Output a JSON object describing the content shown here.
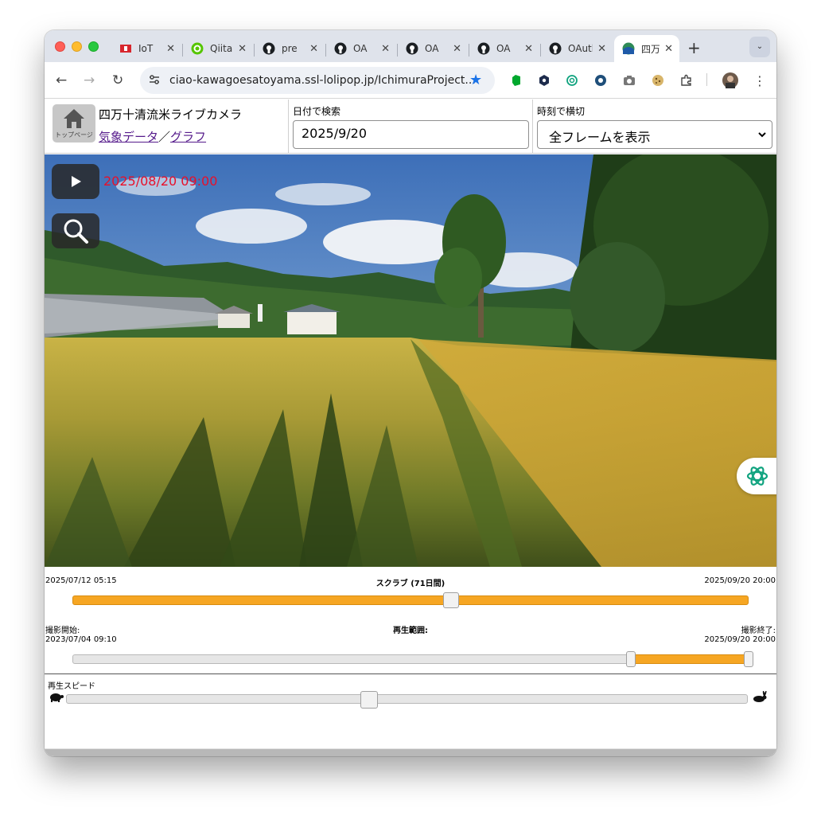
{
  "browser": {
    "tabs": [
      {
        "title": "IoT",
        "icon": "ticket-icon"
      },
      {
        "title": "Qiita",
        "icon": "qiita-icon"
      },
      {
        "title": "pre",
        "icon": "github-icon"
      },
      {
        "title": "OA",
        "icon": "github-icon"
      },
      {
        "title": "OA",
        "icon": "github-icon"
      },
      {
        "title": "OA",
        "icon": "github-icon"
      },
      {
        "title": "OAuth",
        "icon": "github-icon"
      },
      {
        "title": "四万",
        "icon": "site-icon",
        "active": true
      }
    ],
    "url": "ciao-kawagoesatoyama.ssl-lolipop.jp/IchimuraProject...",
    "accent": "#1a73e8"
  },
  "header": {
    "home_label": "トップページ",
    "title": "四万十清流米ライブカメラ",
    "link_weather": "気象データ",
    "link_sep": "／",
    "link_graph": "グラフ",
    "date_search_label": "日付で検索",
    "date_value": "2025/9/20",
    "time_label": "時刻で横切",
    "time_selected": "全フレームを表示"
  },
  "camera": {
    "timestamp": "2025/08/20 09:00"
  },
  "scrub": {
    "start": "2025/07/12 05:15",
    "title": "スクラブ (71日間)",
    "end": "2025/09/20 20:00",
    "position": 0.56
  },
  "range": {
    "start_label": "撮影開始:",
    "start": "2023/07/04 09:10",
    "title": "再生範囲:",
    "end_label": "撮影終了:",
    "end": "2025/09/20 20:00",
    "low": 0.826,
    "high": 1.0
  },
  "speed": {
    "label": "再生スピード",
    "position": 0.445
  },
  "colors": {
    "slider_fill": "#f6a623",
    "timestamp": "#e8102a"
  }
}
